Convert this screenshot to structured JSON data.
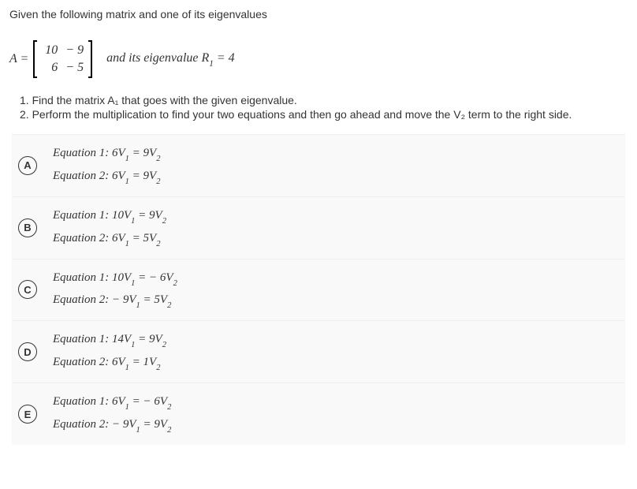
{
  "question_intro": "Given the following matrix and one of its eigenvalues",
  "matrix_label": "A  =",
  "matrix": {
    "r1c1": "10",
    "r1c2": "− 9",
    "r2c1": "6",
    "r2c2": "− 5"
  },
  "eigenvalue_text_prefix": "and  its  eigenvalue   R",
  "eigenvalue_sub": "1",
  "eigenvalue_text_suffix": " = 4",
  "instructions": {
    "line1": "1. Find the matrix A₁ that goes with the given eigenvalue.",
    "line2": "2. Perform the multiplication to find your two equations and then go ahead and move the V₂ term to the right side."
  },
  "options": [
    {
      "label": "A",
      "eq1_prefix": "Equation  1:   6V",
      "eq1_sub1": "1",
      "eq1_mid": " = 9V",
      "eq1_sub2": "2",
      "eq2_prefix": "Equation  2:   6V",
      "eq2_sub1": "1",
      "eq2_mid": " = 9V",
      "eq2_sub2": "2"
    },
    {
      "label": "B",
      "eq1_prefix": "Equation  1:   10V",
      "eq1_sub1": "1",
      "eq1_mid": " = 9V",
      "eq1_sub2": "2",
      "eq2_prefix": "Equation  2:   6V",
      "eq2_sub1": "1",
      "eq2_mid": " = 5V",
      "eq2_sub2": "2"
    },
    {
      "label": "C",
      "eq1_prefix": "Equation  1:   10V",
      "eq1_sub1": "1",
      "eq1_mid": " = − 6V",
      "eq1_sub2": "2",
      "eq2_prefix": "Equation  2:   − 9V",
      "eq2_sub1": "1",
      "eq2_mid": " = 5V",
      "eq2_sub2": "2"
    },
    {
      "label": "D",
      "eq1_prefix": "Equation  1:   14V",
      "eq1_sub1": "1",
      "eq1_mid": " = 9V",
      "eq1_sub2": "2",
      "eq2_prefix": "Equation  2:   6V",
      "eq2_sub1": "1",
      "eq2_mid": " = 1V",
      "eq2_sub2": "2"
    },
    {
      "label": "E",
      "eq1_prefix": "Equation  1:   6V",
      "eq1_sub1": "1",
      "eq1_mid": " = − 6V",
      "eq1_sub2": "2",
      "eq2_prefix": "Equation  2:   − 9V",
      "eq2_sub1": "1",
      "eq2_mid": " = 9V",
      "eq2_sub2": "2"
    }
  ]
}
